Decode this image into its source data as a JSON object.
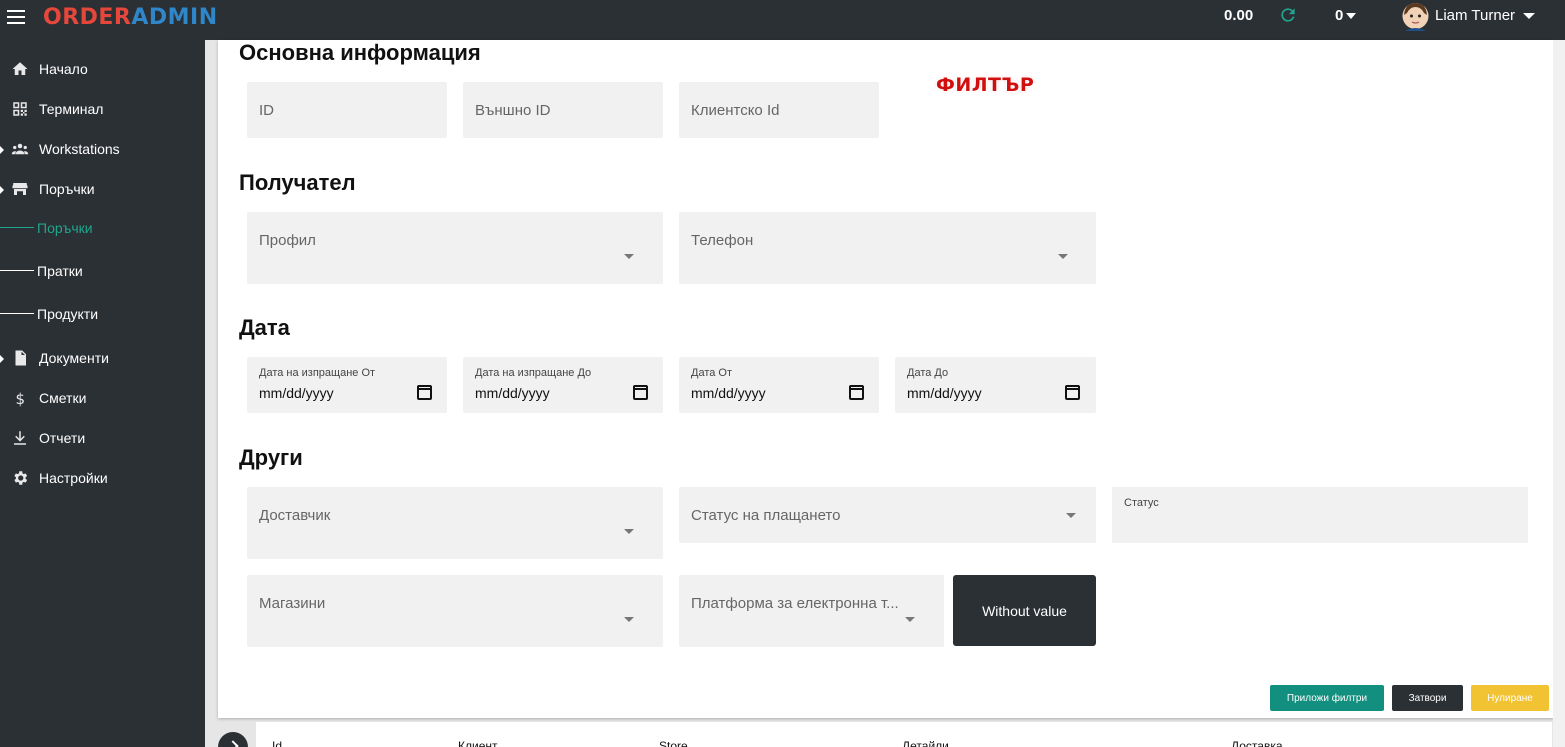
{
  "header": {
    "logo_part1": "ORDER",
    "logo_part2": "ADMIN",
    "balance": "0.00",
    "counter": "0",
    "user_name": "Liam Turner"
  },
  "sidebar": {
    "items": [
      {
        "label": "Начало",
        "icon": "home-icon"
      },
      {
        "label": "Терминал",
        "icon": "qr-icon"
      },
      {
        "label": "Workstations",
        "icon": "people-icon"
      },
      {
        "label": "Поръчки",
        "icon": "store-icon"
      },
      {
        "label": "Документи",
        "icon": "document-icon"
      },
      {
        "label": "Сметки",
        "icon": "dollar-icon"
      },
      {
        "label": "Отчети",
        "icon": "download-icon"
      },
      {
        "label": "Настройки",
        "icon": "gear-icon"
      }
    ],
    "subitems": [
      {
        "label": "Поръчки",
        "active": true
      },
      {
        "label": "Пратки",
        "active": false
      },
      {
        "label": "Продукти",
        "active": false
      }
    ]
  },
  "filter": {
    "badge": "ФИЛТЪР",
    "sections": {
      "basic": "Основна информация",
      "recipient": "Получател",
      "date": "Дата",
      "other": "Други"
    },
    "basic_fields": {
      "id": "ID",
      "external_id": "Външно ID",
      "client_id": "Клиентско Id"
    },
    "recipient_fields": {
      "profile": "Профил",
      "phone": "Телефон"
    },
    "date_fields": {
      "ship_from": {
        "label": "Дата на изпращане От",
        "value": "mm/dd/yyyy"
      },
      "ship_to": {
        "label": "Дата на изпращане До",
        "value": "mm/dd/yyyy"
      },
      "date_from": {
        "label": "Дата От",
        "value": "mm/dd/yyyy"
      },
      "date_to": {
        "label": "Дата До",
        "value": "mm/dd/yyyy"
      }
    },
    "other_fields": {
      "supplier": "Доставчик",
      "payment_status": "Статус на плащането",
      "status": "Статус",
      "stores": "Магазини",
      "platform": "Платформа за електронна т...",
      "without_value": "Without value"
    },
    "actions": {
      "apply": "Приложи филтри",
      "close": "Затвори",
      "reset": "Нулиране"
    },
    "colors": {
      "apply": "#128f7f",
      "close": "#2b3035",
      "reset": "#f1c232"
    }
  },
  "table": {
    "columns": [
      "Id",
      "Клиент",
      "Store",
      "Детайли",
      "Доставка"
    ]
  }
}
